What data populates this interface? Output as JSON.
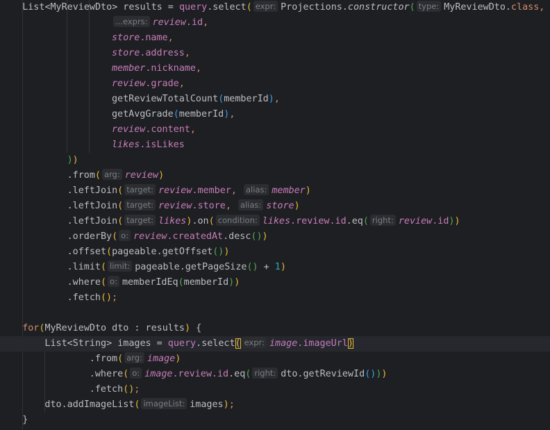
{
  "editor": {
    "lines": [
      {
        "indent": 4,
        "tokens": [
          [
            "List",
            "d"
          ],
          [
            "<",
            "d"
          ],
          [
            "MyReviewDto",
            "d"
          ],
          [
            ">",
            "d"
          ],
          [
            " results = ",
            "d"
          ],
          [
            "query",
            "fld"
          ],
          [
            ".select",
            "d"
          ],
          [
            "(",
            "p1"
          ],
          [
            "expr:",
            "hint"
          ],
          [
            "Projections.",
            "d"
          ],
          [
            "constructor",
            "st"
          ],
          [
            "(",
            "p2"
          ],
          [
            "type:",
            "hint"
          ],
          [
            "MyReviewDto.",
            "d"
          ],
          [
            "class",
            "kw"
          ],
          [
            ",",
            "kw"
          ]
        ]
      },
      {
        "indent": 20,
        "tokens": [
          [
            "...exprs:",
            "hint"
          ],
          [
            "review",
            "v"
          ],
          [
            ".id",
            "fld"
          ],
          [
            ",",
            "kw"
          ]
        ]
      },
      {
        "indent": 20,
        "tokens": [
          [
            "store",
            "v"
          ],
          [
            ".name",
            "fld"
          ],
          [
            ",",
            "kw"
          ]
        ]
      },
      {
        "indent": 20,
        "tokens": [
          [
            "store",
            "v"
          ],
          [
            ".address",
            "fld"
          ],
          [
            ",",
            "kw"
          ]
        ]
      },
      {
        "indent": 20,
        "tokens": [
          [
            "member",
            "v"
          ],
          [
            ".nickname",
            "fld"
          ],
          [
            ",",
            "kw"
          ]
        ]
      },
      {
        "indent": 20,
        "tokens": [
          [
            "review",
            "v"
          ],
          [
            ".grade",
            "fld"
          ],
          [
            ",",
            "kw"
          ]
        ]
      },
      {
        "indent": 20,
        "tokens": [
          [
            "getReviewTotalCount",
            "d"
          ],
          [
            "(",
            "p3"
          ],
          [
            "memberId",
            "d"
          ],
          [
            ")",
            "p3"
          ],
          [
            ",",
            "kw"
          ]
        ]
      },
      {
        "indent": 20,
        "tokens": [
          [
            "getAvgGrade",
            "d"
          ],
          [
            "(",
            "p3"
          ],
          [
            "memberId",
            "d"
          ],
          [
            ")",
            "p3"
          ],
          [
            ",",
            "kw"
          ]
        ]
      },
      {
        "indent": 20,
        "tokens": [
          [
            "review",
            "v"
          ],
          [
            ".content",
            "fld"
          ],
          [
            ",",
            "kw"
          ]
        ]
      },
      {
        "indent": 20,
        "tokens": [
          [
            "likes",
            "v"
          ],
          [
            ".isLikes",
            "fld"
          ]
        ]
      },
      {
        "indent": 12,
        "tokens": [
          [
            ")",
            "p2"
          ],
          [
            ")",
            "p1"
          ]
        ]
      },
      {
        "indent": 12,
        "tokens": [
          [
            ".from",
            "d"
          ],
          [
            "(",
            "p1"
          ],
          [
            "arg:",
            "hint"
          ],
          [
            "review",
            "v"
          ],
          [
            ")",
            "p1"
          ]
        ]
      },
      {
        "indent": 12,
        "tokens": [
          [
            ".leftJoin",
            "d"
          ],
          [
            "(",
            "p1"
          ],
          [
            "target:",
            "hint"
          ],
          [
            "review",
            "v"
          ],
          [
            ".member",
            "fld"
          ],
          [
            ", ",
            "kw"
          ],
          [
            "alias:",
            "hint"
          ],
          [
            "member",
            "v"
          ],
          [
            ")",
            "p1"
          ]
        ]
      },
      {
        "indent": 12,
        "tokens": [
          [
            ".leftJoin",
            "d"
          ],
          [
            "(",
            "p1"
          ],
          [
            "target:",
            "hint"
          ],
          [
            "review",
            "v"
          ],
          [
            ".store",
            "fld"
          ],
          [
            ", ",
            "kw"
          ],
          [
            "alias:",
            "hint"
          ],
          [
            "store",
            "v"
          ],
          [
            ")",
            "p1"
          ]
        ]
      },
      {
        "indent": 12,
        "tokens": [
          [
            ".leftJoin",
            "d"
          ],
          [
            "(",
            "p1"
          ],
          [
            "target:",
            "hint"
          ],
          [
            "likes",
            "v"
          ],
          [
            ")",
            "p1"
          ],
          [
            ".on",
            "d"
          ],
          [
            "(",
            "p1"
          ],
          [
            "condition:",
            "hint"
          ],
          [
            "likes",
            "v"
          ],
          [
            ".review",
            "fld"
          ],
          [
            ".id",
            "fld"
          ],
          [
            ".eq",
            "d"
          ],
          [
            "(",
            "p2"
          ],
          [
            "right:",
            "hint"
          ],
          [
            "review",
            "v"
          ],
          [
            ".id",
            "fld"
          ],
          [
            ")",
            "p2"
          ],
          [
            ")",
            "p1"
          ]
        ]
      },
      {
        "indent": 12,
        "tokens": [
          [
            ".orderBy",
            "d"
          ],
          [
            "(",
            "p1"
          ],
          [
            "o:",
            "hint"
          ],
          [
            "review",
            "v"
          ],
          [
            ".createdAt",
            "fld"
          ],
          [
            ".desc",
            "d"
          ],
          [
            "(",
            "p2"
          ],
          [
            ")",
            "p2"
          ],
          [
            ")",
            "p1"
          ]
        ]
      },
      {
        "indent": 12,
        "tokens": [
          [
            ".offset",
            "d"
          ],
          [
            "(",
            "p1"
          ],
          [
            "pageable.getOffset",
            "d"
          ],
          [
            "(",
            "p2"
          ],
          [
            ")",
            "p2"
          ],
          [
            ")",
            "p1"
          ]
        ]
      },
      {
        "indent": 12,
        "tokens": [
          [
            ".limit",
            "d"
          ],
          [
            "(",
            "p1"
          ],
          [
            "limit:",
            "hint"
          ],
          [
            "pageable.getPageSize",
            "d"
          ],
          [
            "(",
            "p2"
          ],
          [
            ")",
            "p2"
          ],
          [
            " + ",
            "op"
          ],
          [
            "1",
            "num"
          ],
          [
            ")",
            "p1"
          ]
        ]
      },
      {
        "indent": 12,
        "tokens": [
          [
            ".where",
            "d"
          ],
          [
            "(",
            "p1"
          ],
          [
            "o:",
            "hint"
          ],
          [
            "memberIdEq",
            "d"
          ],
          [
            "(",
            "p2"
          ],
          [
            "memberId",
            "d"
          ],
          [
            ")",
            "p2"
          ],
          [
            ")",
            "p1"
          ]
        ]
      },
      {
        "indent": 12,
        "tokens": [
          [
            ".fetch",
            "d"
          ],
          [
            "(",
            "p1"
          ],
          [
            ")",
            "p1"
          ],
          [
            ";",
            "kw"
          ]
        ]
      },
      {
        "indent": 0,
        "tokens": []
      },
      {
        "indent": 4,
        "tokens": [
          [
            "for",
            "kw"
          ],
          [
            "(",
            "p1"
          ],
          [
            "MyReviewDto dto : results",
            "d"
          ],
          [
            ")",
            "p1"
          ],
          [
            " {",
            "d"
          ]
        ]
      },
      {
        "indent": 8,
        "current": true,
        "tokens": [
          [
            "List",
            "d"
          ],
          [
            "<",
            "d"
          ],
          [
            "String",
            "d"
          ],
          [
            ">",
            "d"
          ],
          [
            " images = ",
            "d"
          ],
          [
            "query",
            "fld"
          ],
          [
            ".select",
            "d"
          ],
          [
            "(",
            "p1m"
          ],
          [
            "expr:",
            "hint"
          ],
          [
            "image",
            "v"
          ],
          [
            ".imageUrl",
            "fld"
          ],
          [
            ")",
            "p1m"
          ]
        ]
      },
      {
        "indent": 16,
        "tokens": [
          [
            ".from",
            "d"
          ],
          [
            "(",
            "p1"
          ],
          [
            "arg:",
            "hint"
          ],
          [
            "image",
            "v"
          ],
          [
            ")",
            "p1"
          ]
        ]
      },
      {
        "indent": 16,
        "tokens": [
          [
            ".where",
            "d"
          ],
          [
            "(",
            "p1"
          ],
          [
            "o:",
            "hint"
          ],
          [
            "image",
            "v"
          ],
          [
            ".review",
            "fld"
          ],
          [
            ".id",
            "fld"
          ],
          [
            ".eq",
            "d"
          ],
          [
            "(",
            "p2"
          ],
          [
            "right:",
            "hint"
          ],
          [
            "dto.getReviewId",
            "d"
          ],
          [
            "(",
            "p3"
          ],
          [
            ")",
            "p3"
          ],
          [
            ")",
            "p2"
          ],
          [
            ")",
            "p1"
          ]
        ]
      },
      {
        "indent": 16,
        "tokens": [
          [
            ".fetch",
            "d"
          ],
          [
            "(",
            "p1"
          ],
          [
            ")",
            "p1"
          ],
          [
            ";",
            "kw"
          ]
        ]
      },
      {
        "indent": 8,
        "tokens": [
          [
            "dto.addImageList",
            "d"
          ],
          [
            "(",
            "p1"
          ],
          [
            "imageList:",
            "hint"
          ],
          [
            "images",
            "d"
          ],
          [
            ")",
            "p1"
          ],
          [
            ";",
            "kw"
          ]
        ]
      },
      {
        "indent": 4,
        "tokens": [
          [
            "}",
            "d"
          ]
        ]
      }
    ]
  },
  "colors": {
    "background": "#1e1f22",
    "current_line": "#26282e",
    "keyword": "#cf8e6d",
    "field": "#c77dbb",
    "number": "#2aacb8",
    "paren_level_1": "#e8ba36",
    "paren_level_2": "#54a857",
    "paren_level_3": "#359ff4"
  }
}
